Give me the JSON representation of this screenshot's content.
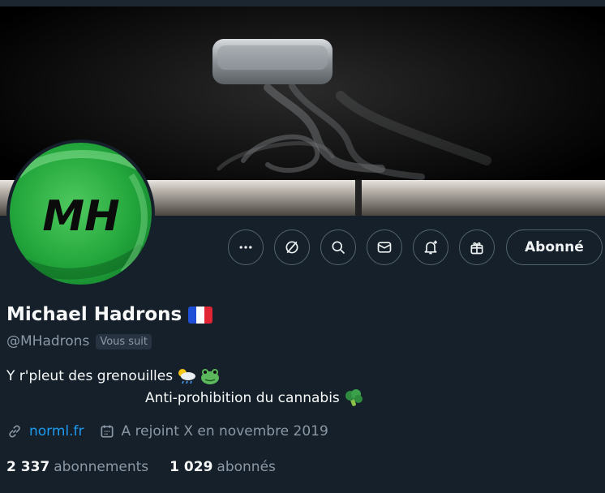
{
  "profile": {
    "name": "Michael Hadrons",
    "handle": "@MHadrons",
    "follows_you": "Vous suit",
    "avatar_text": "MH",
    "bio_line1": "Y r'pleut des grenouilles",
    "bio_line2": "Anti-prohibition du cannabis",
    "website": "norml.fr",
    "joined": "A rejoint X en novembre 2019",
    "following_count": "2 337",
    "following_label": "abonnements",
    "followers_count": "1 029",
    "followers_label": "abonnés"
  },
  "actions": {
    "follow_label": "Abonné",
    "icons": [
      "more-icon",
      "grok-icon",
      "search-icon",
      "message-icon",
      "notification-bell-icon",
      "gift-icon"
    ]
  },
  "colors": {
    "background": "#15202b",
    "link": "#1d9bf0",
    "muted": "#8b98a5",
    "avatar_green": "#1fa33a"
  }
}
